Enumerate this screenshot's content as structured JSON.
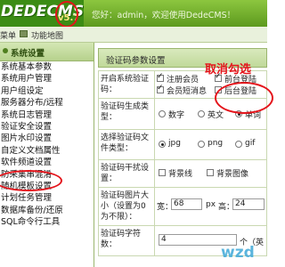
{
  "brand": {
    "name": "DEDECMS",
    "version": "v5.7"
  },
  "header": {
    "welcome": "您好：admin，欢迎使用DedeCMS！"
  },
  "nav": {
    "menu": "菜单",
    "sitemap": "功能地图"
  },
  "sidebar": {
    "title": "系统设置",
    "items": [
      {
        "label": "系统基本参数"
      },
      {
        "label": "系统用户管理"
      },
      {
        "label": "用户组设定"
      },
      {
        "label": "服务器分布/远程"
      },
      {
        "label": "系统日志管理"
      },
      {
        "label": "验证安全设置"
      },
      {
        "label": "图片水印设置"
      },
      {
        "label": "自定义文档属性"
      },
      {
        "label": "软件频道设置"
      },
      {
        "label": "防采集串混淆"
      },
      {
        "label": "随机模板设置"
      },
      {
        "label": "计划任务管理"
      },
      {
        "label": "数据库备份/还原"
      },
      {
        "label": "SQL命令行工具"
      }
    ]
  },
  "main": {
    "title": "验证码参数设置",
    "rows": {
      "enable": {
        "label": "开启系统验证码：",
        "options": [
          "注册会员",
          "前台登陆",
          "会员短消息",
          "后台登陆"
        ]
      },
      "type": {
        "label": "验证码生成类型：",
        "options": [
          "数字",
          "英文",
          "单词"
        ],
        "selected": "单词"
      },
      "format": {
        "label": "选择验证码文件类型：",
        "options": [
          "jpg",
          "png",
          "gif"
        ],
        "selected": "jpg"
      },
      "interference": {
        "label": "验证码干扰设置：",
        "options": [
          "背景线",
          "背景图像"
        ]
      },
      "size": {
        "label": "验证码图片大小（设置为0为不限）：",
        "width_label": "宽：",
        "width": "68",
        "unit": "px",
        "height_label": "高：",
        "height": "24"
      },
      "length": {
        "label": "验证码字符数：",
        "value": "4",
        "unit": "个（英"
      }
    }
  },
  "annotation": {
    "text": "取消勾选"
  },
  "watermark": {
    "text": "wzd"
  }
}
